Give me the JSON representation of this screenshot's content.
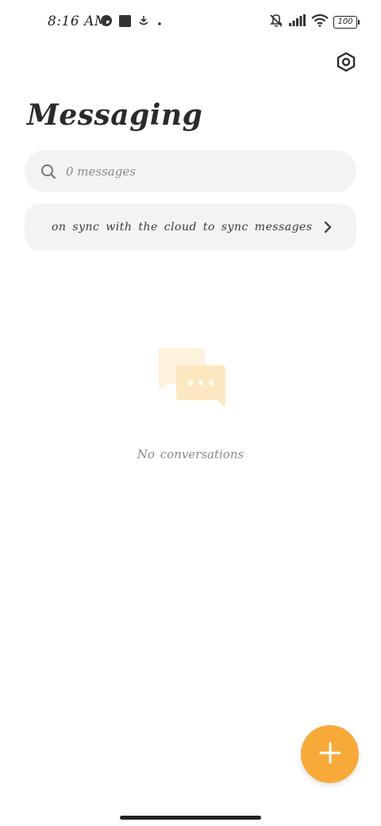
{
  "status_bar": {
    "time": "8:16 AM",
    "battery_level": "100",
    "icons_left": [
      "flipboard-icon",
      "app-square-icon",
      "download-icon",
      "dot-icon"
    ],
    "icons_right": [
      "silent-icon",
      "signal-icon",
      "wifi-icon",
      "battery-icon"
    ]
  },
  "header": {
    "title": "Messaging",
    "settings_icon": "settings-hexagon-icon"
  },
  "search": {
    "placeholder": "0 messages",
    "icon": "search-icon"
  },
  "sync_banner": {
    "text": "on sync with the cloud to sync messages",
    "icon": "chevron-right-icon"
  },
  "empty_state": {
    "text": "No conversations",
    "icon": "chat-bubbles-icon"
  },
  "fab": {
    "icon": "plus-icon"
  },
  "colors": {
    "accent": "#f7aa3a",
    "surface": "#f3f3f3",
    "illustration_light": "#fdf3dc",
    "illustration_mid": "#fce7bd"
  }
}
